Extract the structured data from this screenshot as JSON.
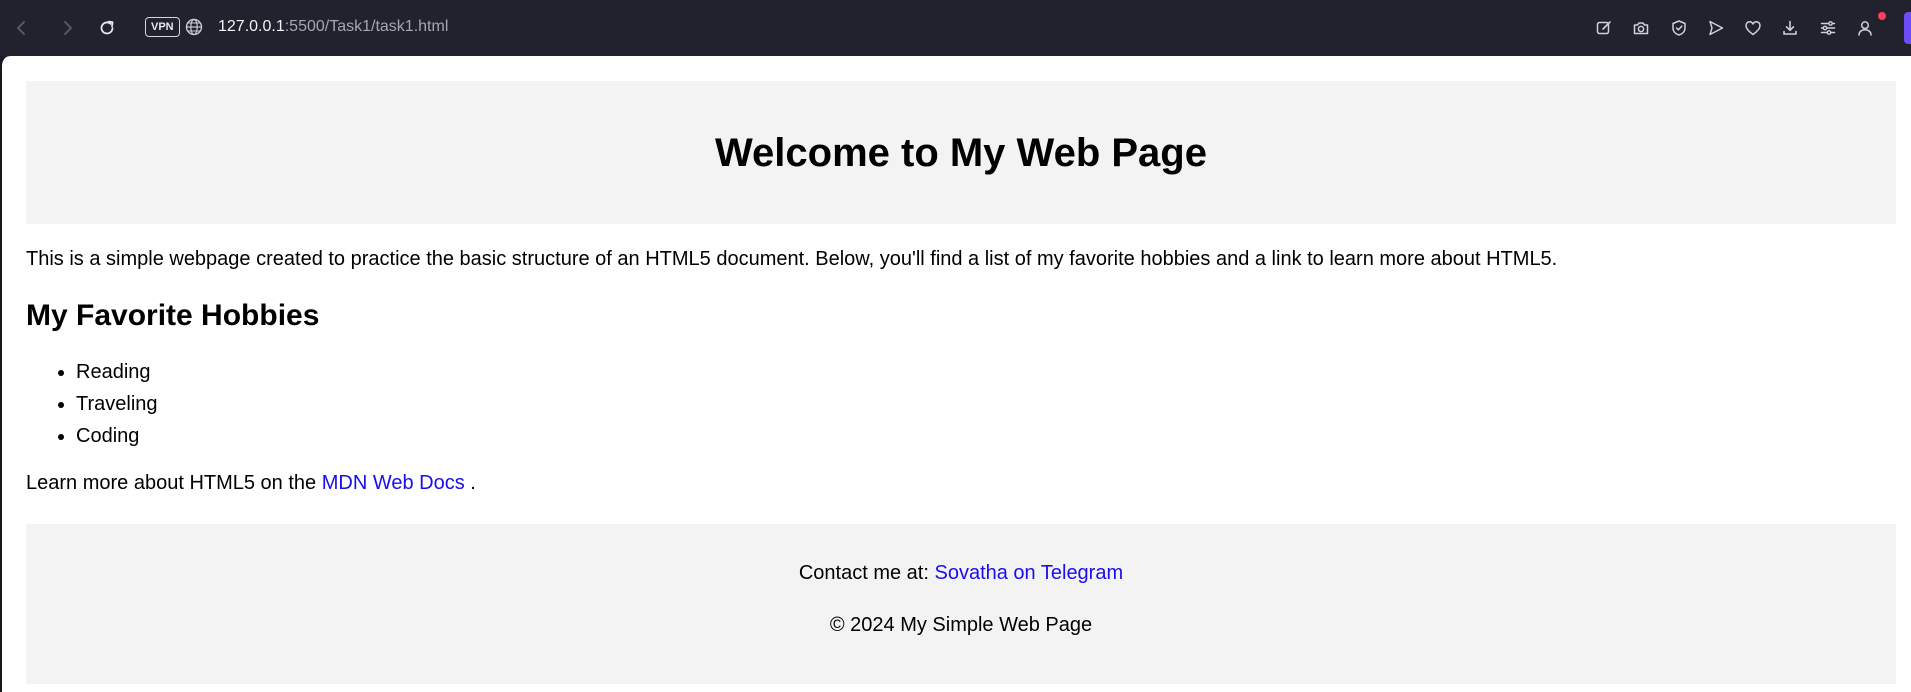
{
  "browser": {
    "url_host": "127.0.0.1",
    "url_path": ":5500/Task1/task1.html",
    "vpn_label": "VPN",
    "icons": {
      "back": "back-arrow-icon",
      "forward": "forward-arrow-icon",
      "reload": "reload-icon",
      "site": "globe-icon",
      "edit": "edit-icon",
      "snapshot": "camera-icon",
      "shield": "shield-icon",
      "send": "send-icon",
      "favorites": "heart-icon",
      "downloads": "download-icon",
      "easy_setup": "sliders-icon",
      "profile": "profile-icon"
    },
    "accent_color": "#6c4cf5",
    "notification_color": "#ff3b5f"
  },
  "page": {
    "title": "Welcome to My Web Page",
    "intro": "This is a simple webpage created to practice the basic structure of an HTML5 document. Below, you'll find a list of my favorite hobbies and a link to learn more about HTML5.",
    "hobbies_title": "My Favorite Hobbies",
    "hobbies": [
      "Reading",
      "Traveling",
      "Coding"
    ],
    "learn_prefix": "Learn more about HTML5 on the ",
    "learn_link": "MDN Web Docs",
    "learn_suffix": " .",
    "link_color": "#1a0dee",
    "header_bg": "#f3f3f3"
  },
  "footer": {
    "contact_prefix": "Contact me at: ",
    "contact_link": "Sovatha on Telegram",
    "copyright": "© 2024 My Simple Web Page"
  }
}
